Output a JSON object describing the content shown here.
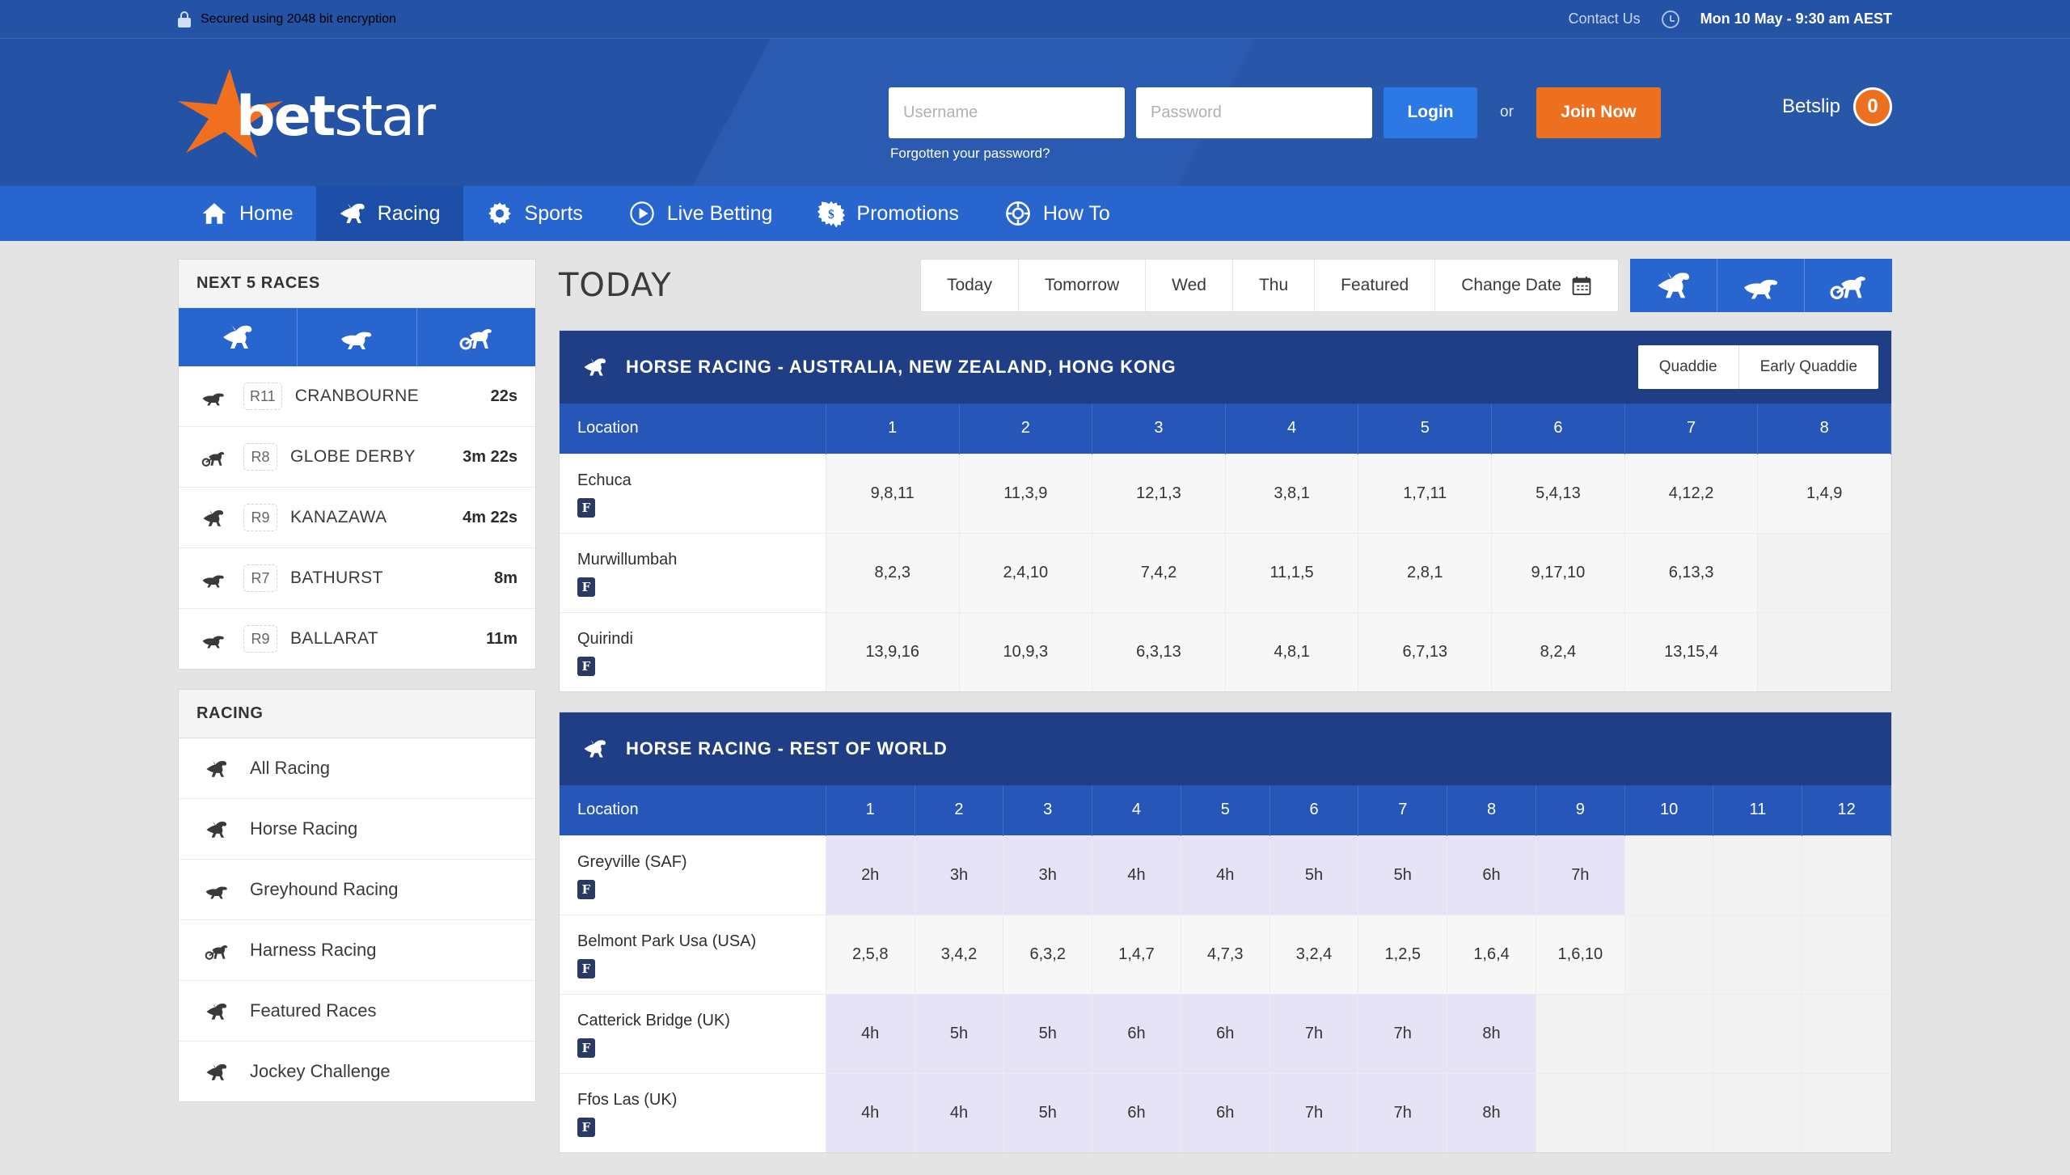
{
  "utility": {
    "secure_text": "Secured using 2048 bit encryption",
    "contact_label": "Contact Us",
    "datetime": "Mon 10 May - 9:30 am AEST"
  },
  "brand": {
    "name_bold": "bet",
    "name_light": "star"
  },
  "login": {
    "username_placeholder": "Username",
    "password_placeholder": "Password",
    "username_value": "",
    "password_value": "",
    "login_label": "Login",
    "or_label": "or",
    "join_label": "Join Now",
    "forgot_label": "Forgotten your password?",
    "betslip_label": "Betslip",
    "betslip_count": "0"
  },
  "nav": {
    "items": [
      {
        "label": "Home",
        "icon": "home-icon",
        "active": false
      },
      {
        "label": "Racing",
        "icon": "horse-icon",
        "active": true
      },
      {
        "label": "Sports",
        "icon": "gear-icon",
        "active": false
      },
      {
        "label": "Live Betting",
        "icon": "play-circle-icon",
        "active": false
      },
      {
        "label": "Promotions",
        "icon": "dollar-burst-icon",
        "active": false
      },
      {
        "label": "How To",
        "icon": "lifebuoy-icon",
        "active": false
      }
    ]
  },
  "sidebar": {
    "next_races_title": "NEXT 5 RACES",
    "sport_tabs": [
      {
        "icon": "horse-icon"
      },
      {
        "icon": "greyhound-icon"
      },
      {
        "icon": "harness-icon"
      }
    ],
    "next_races": [
      {
        "icon": "greyhound-icon",
        "race": "R11",
        "name": "CRANBOURNE",
        "time": "22s"
      },
      {
        "icon": "harness-icon",
        "race": "R8",
        "name": "GLOBE DERBY",
        "time": "3m 22s"
      },
      {
        "icon": "horse-icon",
        "race": "R9",
        "name": "KANAZAWA",
        "time": "4m 22s"
      },
      {
        "icon": "greyhound-icon",
        "race": "R7",
        "name": "BATHURST",
        "time": "8m"
      },
      {
        "icon": "greyhound-icon",
        "race": "R9",
        "name": "BALLARAT",
        "time": "11m"
      }
    ],
    "racing_title": "RACING",
    "racing_menu": [
      {
        "icon": "horse-icon",
        "label": "All Racing"
      },
      {
        "icon": "horse-icon",
        "label": "Horse Racing"
      },
      {
        "icon": "greyhound-icon",
        "label": "Greyhound Racing"
      },
      {
        "icon": "harness-icon",
        "label": "Harness Racing"
      },
      {
        "icon": "horse-icon",
        "label": "Featured Races"
      },
      {
        "icon": "horse-icon",
        "label": "Jockey Challenge"
      }
    ]
  },
  "main": {
    "page_title": "TODAY",
    "date_tabs": [
      {
        "label": "Today",
        "active": true
      },
      {
        "label": "Tomorrow",
        "active": false
      },
      {
        "label": "Wed",
        "active": false
      },
      {
        "label": "Thu",
        "active": false
      },
      {
        "label": "Featured",
        "active": false
      },
      {
        "label": "Change Date",
        "active": false,
        "icon": "calendar-icon"
      }
    ],
    "code_tabs": [
      {
        "icon": "horse-icon"
      },
      {
        "icon": "greyhound-icon"
      },
      {
        "icon": "harness-icon"
      }
    ]
  },
  "tables": [
    {
      "title": "HORSE RACING - AUSTRALIA, NEW ZEALAND, HONG KONG",
      "icon": "horse-icon",
      "buttons": [
        "Quaddie",
        "Early Quaddie"
      ],
      "columns": [
        "Location",
        "1",
        "2",
        "3",
        "4",
        "5",
        "6",
        "7",
        "8"
      ],
      "rows": [
        {
          "location": "Echuca",
          "badge": "F",
          "highlight": false,
          "cells": [
            "9,8,11",
            "11,3,9",
            "12,1,3",
            "3,8,1",
            "1,7,11",
            "5,4,13",
            "4,12,2",
            "1,4,9"
          ]
        },
        {
          "location": "Murwillumbah",
          "badge": "F",
          "highlight": false,
          "cells": [
            "8,2,3",
            "2,4,10",
            "7,4,2",
            "11,1,5",
            "2,8,1",
            "9,17,10",
            "6,13,3",
            ""
          ]
        },
        {
          "location": "Quirindi",
          "badge": "F",
          "highlight": false,
          "cells": [
            "13,9,16",
            "10,9,3",
            "6,3,13",
            "4,8,1",
            "6,7,13",
            "8,2,4",
            "13,15,4",
            ""
          ]
        }
      ]
    },
    {
      "title": "HORSE RACING - REST OF WORLD",
      "icon": "horse-icon",
      "buttons": [],
      "columns": [
        "Location",
        "1",
        "2",
        "3",
        "4",
        "5",
        "6",
        "7",
        "8",
        "9",
        "10",
        "11",
        "12"
      ],
      "rows": [
        {
          "location": "Greyville (SAF)",
          "badge": "F",
          "highlight": true,
          "cells": [
            "2h",
            "3h",
            "3h",
            "4h",
            "4h",
            "5h",
            "5h",
            "6h",
            "7h",
            "",
            "",
            ""
          ]
        },
        {
          "location": "Belmont Park Usa (USA)",
          "badge": "F",
          "highlight": false,
          "cells": [
            "2,5,8",
            "3,4,2",
            "6,3,2",
            "1,4,7",
            "4,7,3",
            "3,2,4",
            "1,2,5",
            "1,6,4",
            "1,6,10",
            "",
            "",
            ""
          ]
        },
        {
          "location": "Catterick Bridge (UK)",
          "badge": "F",
          "highlight": true,
          "cells": [
            "4h",
            "5h",
            "5h",
            "6h",
            "6h",
            "7h",
            "7h",
            "8h",
            "",
            "",
            "",
            ""
          ]
        },
        {
          "location": "Ffos Las (UK)",
          "badge": "F",
          "highlight": true,
          "cells": [
            "4h",
            "4h",
            "5h",
            "6h",
            "6h",
            "7h",
            "7h",
            "8h",
            "",
            "",
            "",
            ""
          ]
        }
      ]
    }
  ],
  "colors": {
    "header_blue": "#2453a6",
    "nav_blue": "#2865ce",
    "table_title_navy": "#1f3e85",
    "table_header_blue": "#2657b8",
    "accent_orange": "#ed7021",
    "highlight_lavender": "#e6e3f7"
  }
}
